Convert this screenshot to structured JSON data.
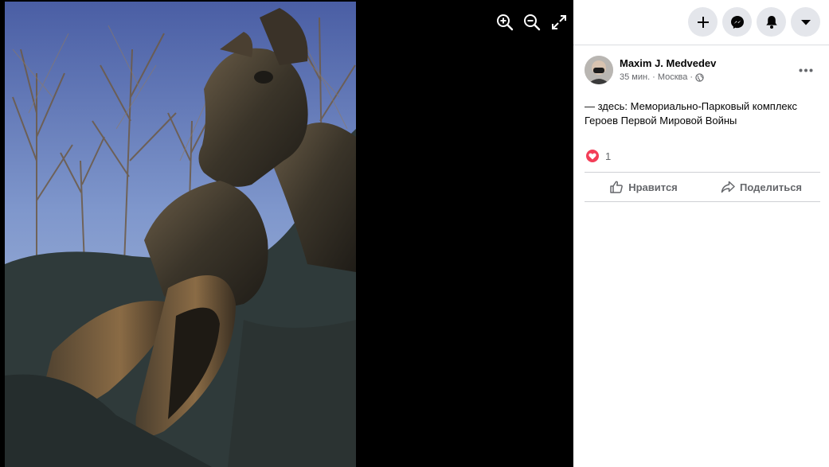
{
  "viewer": {
    "tools": [
      {
        "icon": "zoom-in-icon"
      },
      {
        "icon": "zoom-out-icon"
      },
      {
        "icon": "fullscreen-icon"
      }
    ]
  },
  "topbar": {
    "buttons": [
      {
        "icon": "plus-icon"
      },
      {
        "icon": "messenger-icon"
      },
      {
        "icon": "bell-icon"
      },
      {
        "icon": "caret-down-icon"
      }
    ]
  },
  "post": {
    "author": "Maxim J. Medvedev",
    "time": "35 мин.",
    "location": "Москва",
    "audience_icon": "globe-icon",
    "text": "— здесь: Мемориально-Парковый комплекс Героев Первой Мировой Войны",
    "reaction_count": "1",
    "reaction_icon": "love-reaction-icon"
  },
  "actions": {
    "like_label": "Нравится",
    "share_label": "Поделиться"
  },
  "colors": {
    "viewer_bg": "#000000",
    "button_bg": "#e4e6eb",
    "secondary_text": "#65676b",
    "love": "#f33e58"
  }
}
